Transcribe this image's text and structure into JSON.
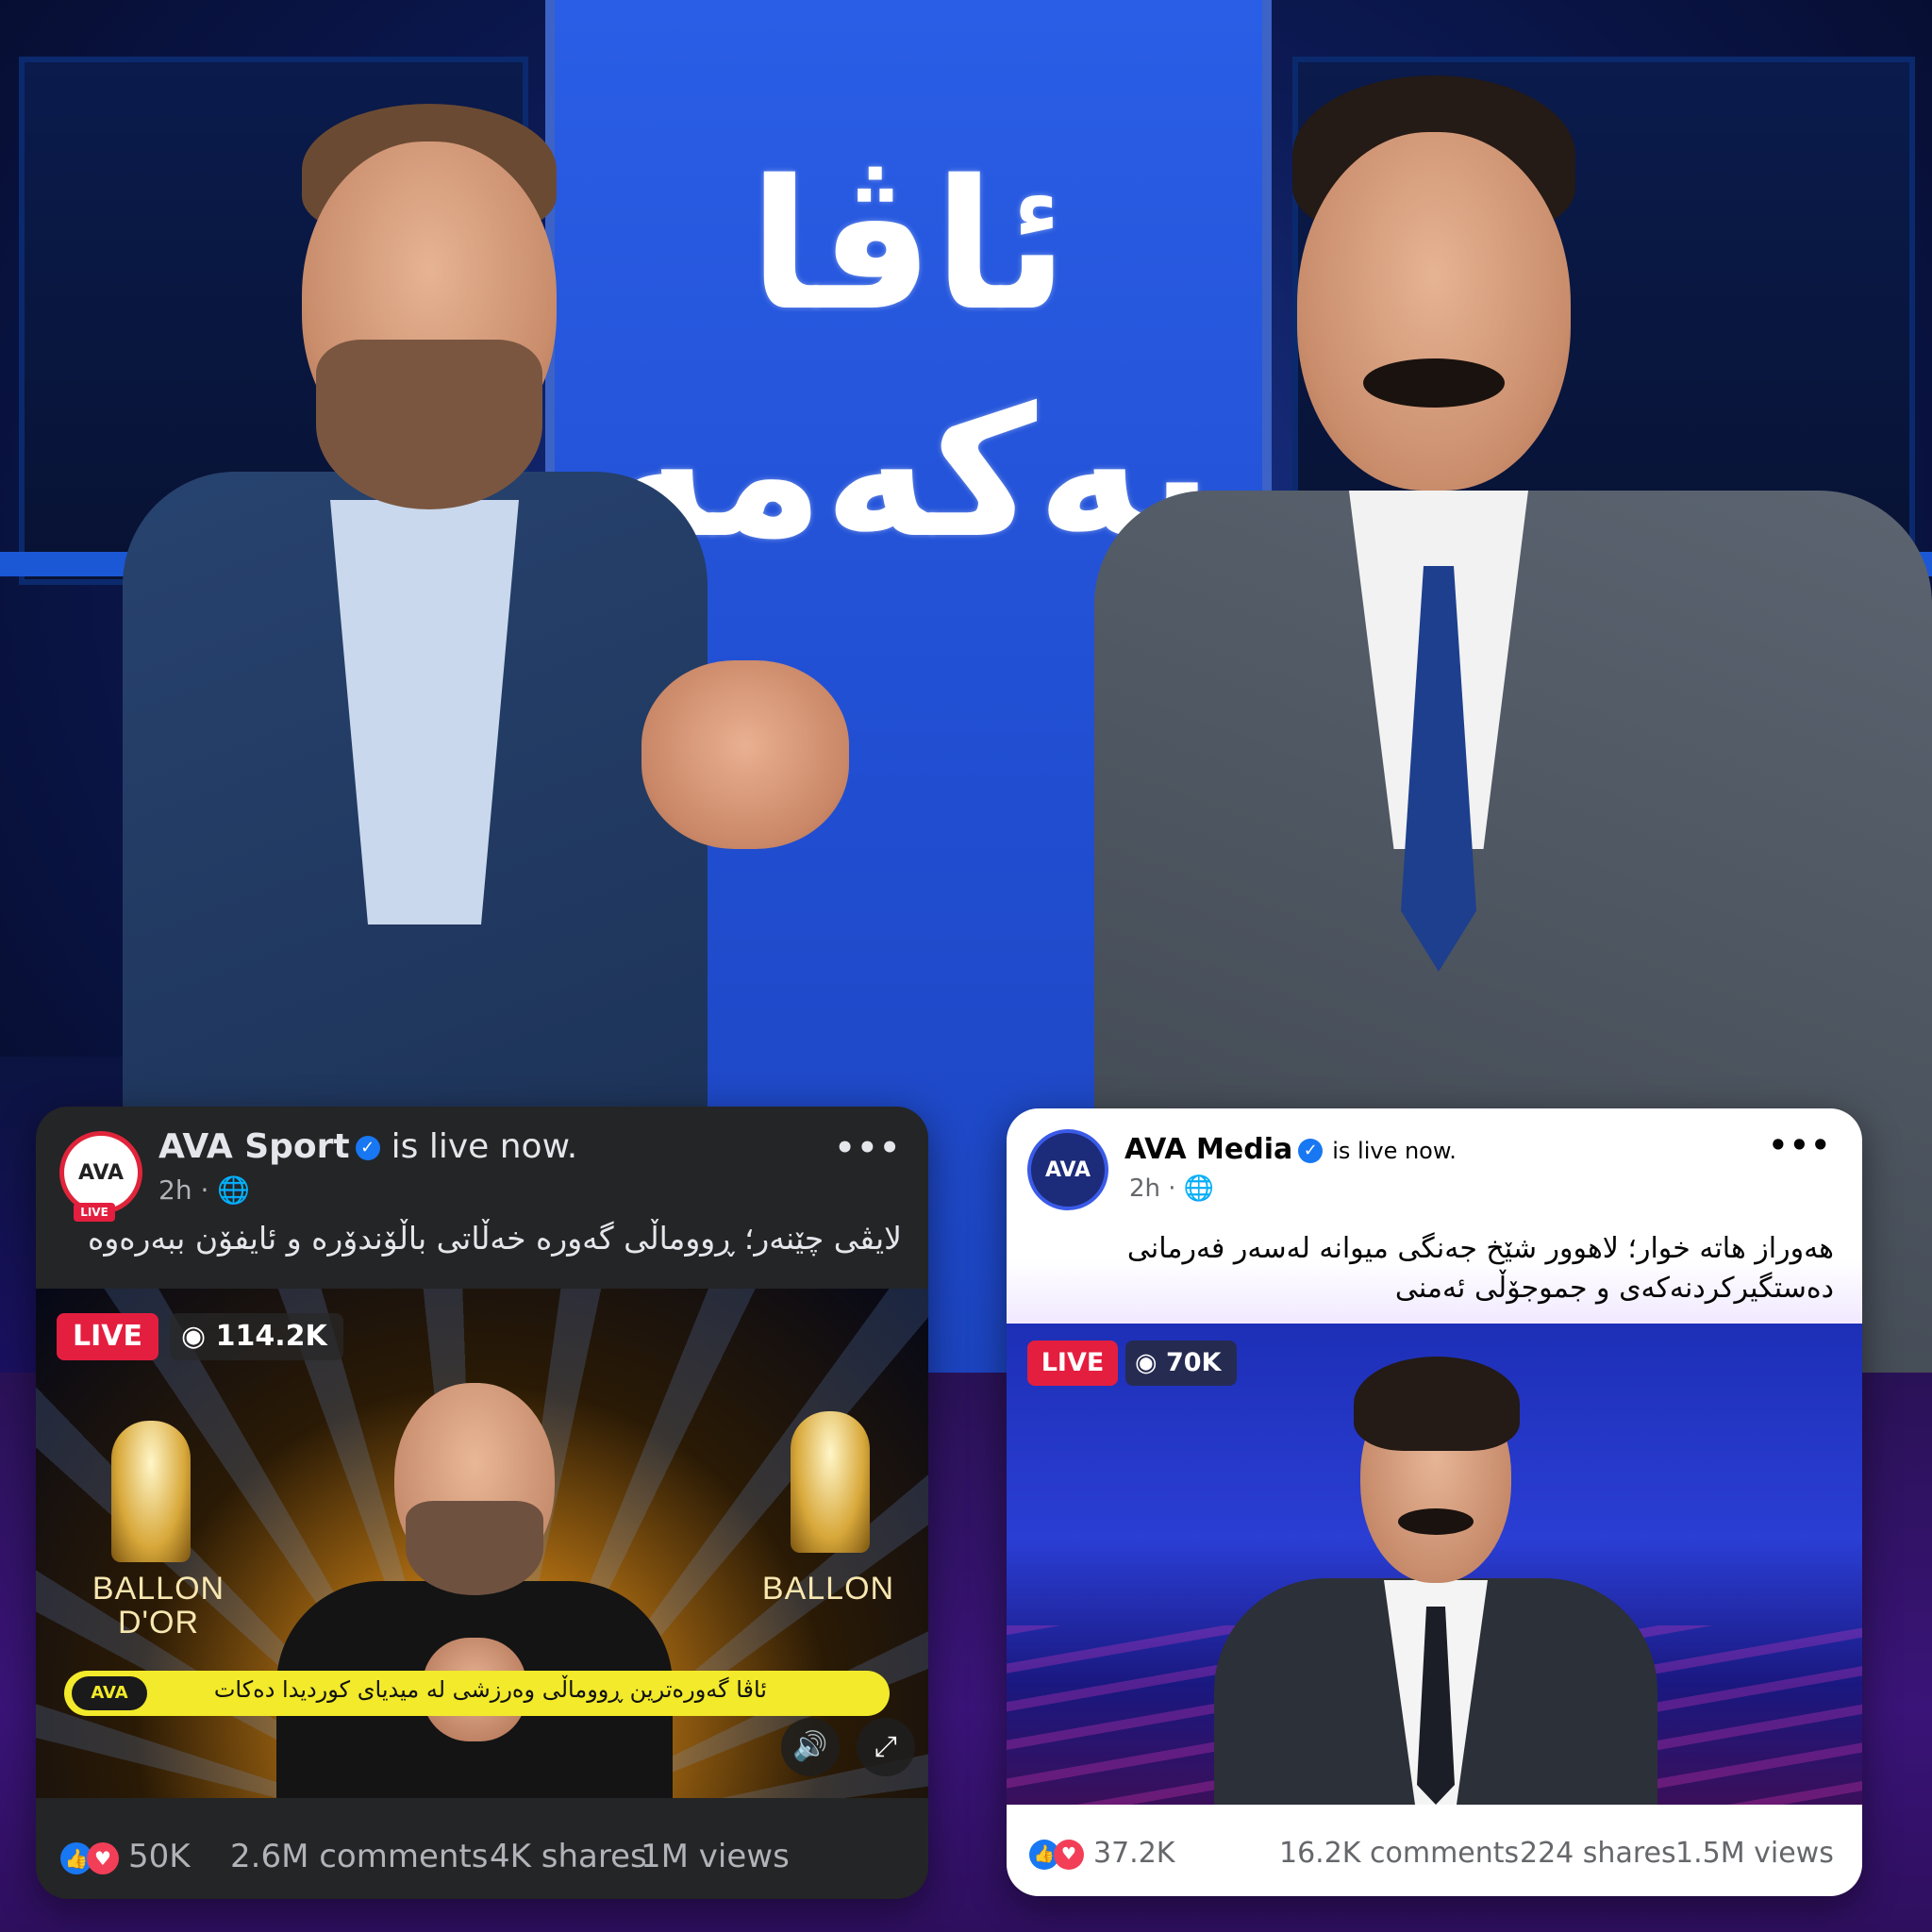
{
  "studio": {
    "brand_line1": "ئاڤا",
    "brand_line2": "یەکەمە"
  },
  "posts": [
    {
      "theme": "dark",
      "page_name": "AVA Sport",
      "status": "is live now.",
      "time": "2h",
      "visibility_icon": "globe-icon",
      "avatar_logo": "AVA",
      "avatar_sub": "LIVE",
      "caption": "لایڤی چێنەر؛ ڕووماڵی گەورە خەڵاتی باڵۆندۆرە و ئایفۆن ببەرەوە",
      "live_label": "LIVE",
      "viewers": "114.2K",
      "video": {
        "ballon_left": "BALLON D'OR",
        "ballon_right": "BALLON",
        "ticker_logo": "AVA",
        "ticker_text": "ئاڤا گەورەترین ڕووماڵی وەرزشی لە میدیای کوردیدا دەکات"
      },
      "reactions": "50K",
      "comments": "2.6M comments",
      "shares": "4K shares",
      "views": "1M views"
    },
    {
      "theme": "light",
      "page_name": "AVA Media",
      "status": "is live now.",
      "time": "2h",
      "visibility_icon": "globe-icon",
      "avatar_logo": "AVA",
      "caption": "هەوراز هاتە خوار؛ لاهوور شێخ جەنگی میوانە لەسەر فەرمانی دەستگیرکردنەکەی و جموجۆڵی ئەمنی",
      "live_label": "LIVE",
      "viewers": "70K",
      "reactions": "37.2K",
      "comments": "16.2K comments",
      "shares": "224 shares",
      "views": "1.5M views"
    }
  ],
  "colors": {
    "live_red": "#e41e3f",
    "verified_blue": "#1877f2",
    "like_blue": "#1877f2",
    "love_red": "#f33e58",
    "brand_panel": "#2a5ee6"
  }
}
